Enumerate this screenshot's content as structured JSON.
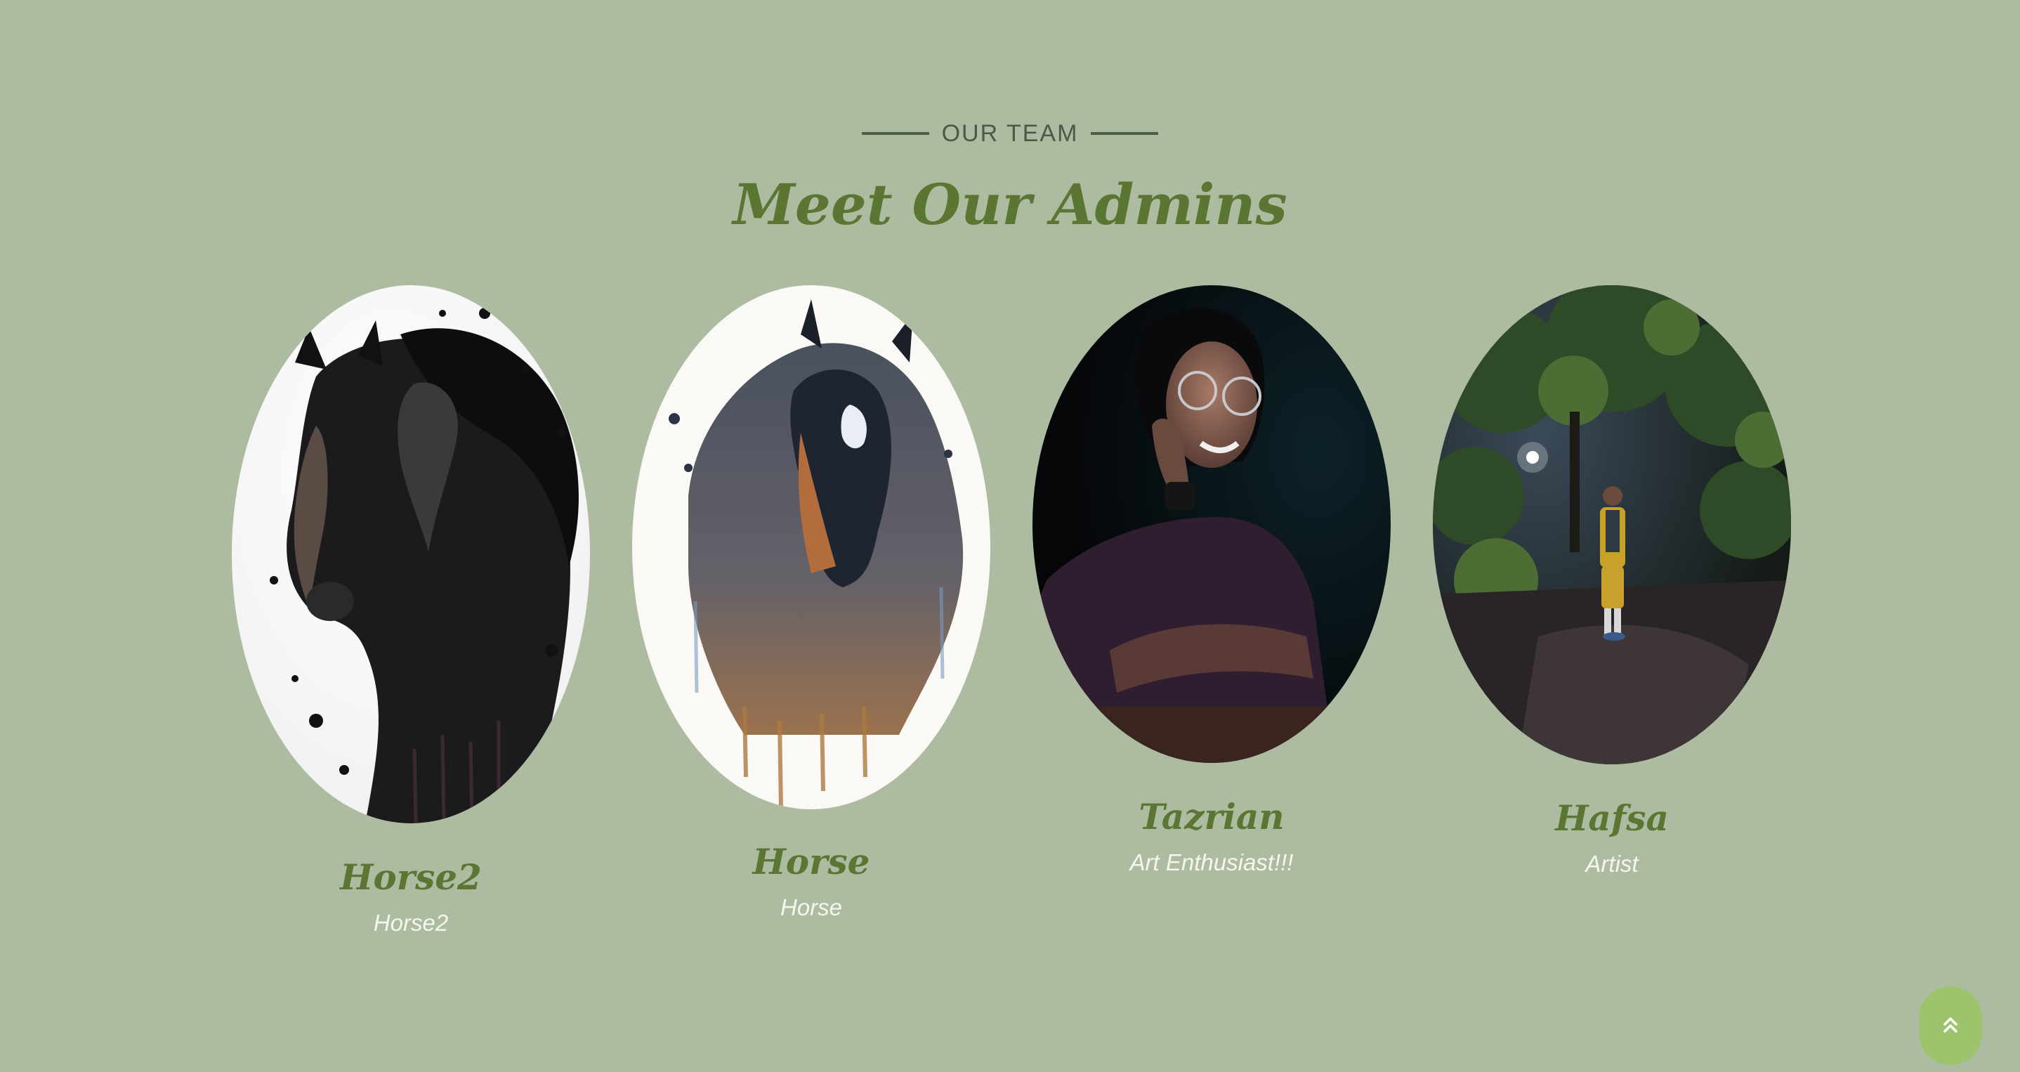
{
  "section": {
    "eyebrow": "OUR TEAM",
    "title": "Meet Our Admins"
  },
  "team": [
    {
      "name": "Horse2",
      "role": "Horse2",
      "photo": "black-horse-ink-painting"
    },
    {
      "name": "Horse",
      "role": "Horse",
      "photo": "watercolor-horse-painting"
    },
    {
      "name": "Tazrian",
      "role": "Art Enthusiast!!!",
      "photo": "portrait-woman-glasses-dark"
    },
    {
      "name": "Hafsa",
      "role": "Artist",
      "photo": "woman-standing-under-trees-night"
    }
  ],
  "back_to_top": {
    "icon": "double-chevron-up-icon"
  },
  "colors": {
    "background": "#adbca0",
    "heading": "#5b7532",
    "eyebrow": "#4a5a44",
    "role_text": "#f5f6ee",
    "button": "#9cc46c"
  }
}
